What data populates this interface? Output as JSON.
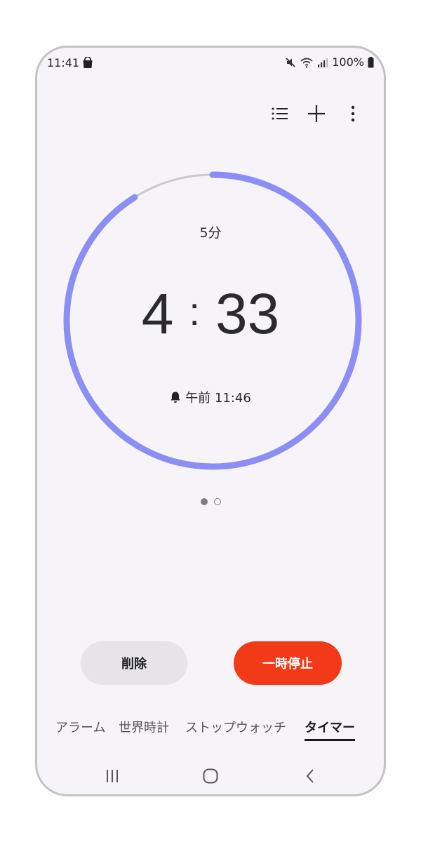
{
  "status_bar": {
    "time": "11:41",
    "battery": "100%"
  },
  "toolbar": {
    "icons": [
      "list-icon",
      "plus-icon",
      "more-vert-icon"
    ]
  },
  "timer": {
    "preset_label": "5分",
    "minutes": "4",
    "separator": ":",
    "seconds": "33",
    "end_time": "午前 11:46",
    "remaining_fraction": 0.91,
    "progress_color": "#8c8ef7",
    "track_color": "#c9c8cd"
  },
  "pager": {
    "pages": 2,
    "active": 0
  },
  "actions": {
    "delete_label": "削除",
    "pause_label": "一時停止",
    "pause_color": "#f23a18"
  },
  "tabs": [
    {
      "label": "アラーム",
      "selected": false
    },
    {
      "label": "世界時計",
      "selected": false
    },
    {
      "label": "ストップウォッチ",
      "selected": false
    },
    {
      "label": "タイマー",
      "selected": true
    }
  ]
}
